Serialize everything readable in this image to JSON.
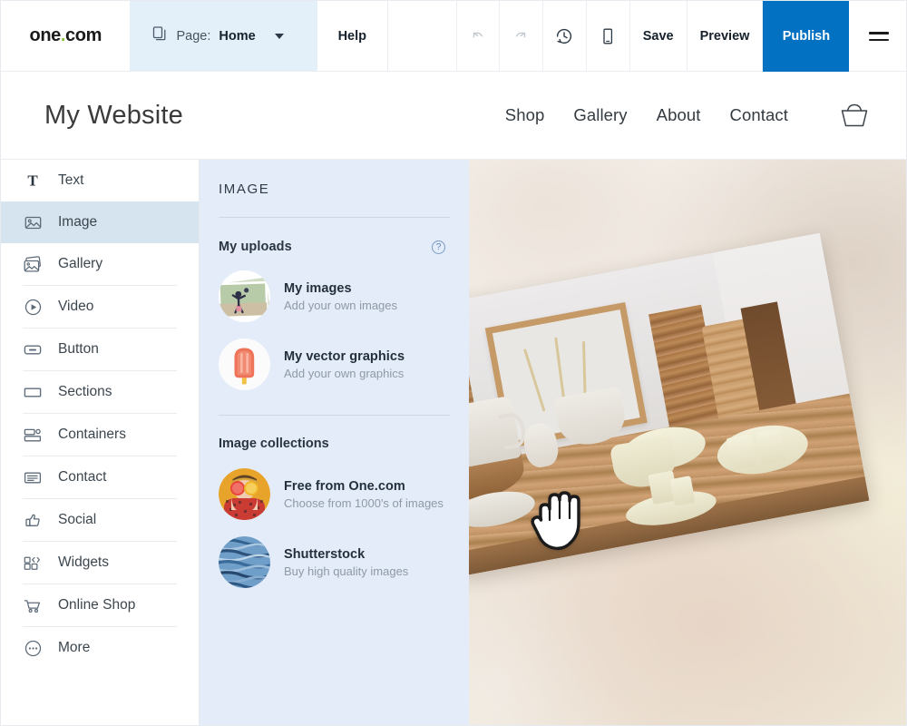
{
  "toolbar": {
    "logo": "one.com",
    "logo_main": "one",
    "logo_dot": ".",
    "logo_suffix": "com",
    "page_label": "Page:",
    "page_value": "Home",
    "help_label": "Help",
    "undo_icon": "undo-icon",
    "redo_icon": "redo-icon",
    "history_icon": "history-clock-icon",
    "mobile_icon": "mobile-preview-icon",
    "save_label": "Save",
    "preview_label": "Preview",
    "publish_label": "Publish",
    "menu_icon": "hamburger-menu-icon",
    "publish_color": "#0271c2",
    "page_bg_color": "#e3f0fa"
  },
  "site_header": {
    "title": "My Website",
    "nav": [
      {
        "label": "Shop"
      },
      {
        "label": "Gallery"
      },
      {
        "label": "About"
      },
      {
        "label": "Contact"
      }
    ],
    "cart_icon": "shopping-basket-icon"
  },
  "sidebar": {
    "items": [
      {
        "label": "Text",
        "icon": "text-t-icon",
        "active": false
      },
      {
        "label": "Image",
        "icon": "image-icon",
        "active": true
      },
      {
        "label": "Gallery",
        "icon": "gallery-stack-icon",
        "active": false
      },
      {
        "label": "Video",
        "icon": "video-play-icon",
        "active": false
      },
      {
        "label": "Button",
        "icon": "button-icon",
        "active": false
      },
      {
        "label": "Sections",
        "icon": "sections-icon",
        "active": false
      },
      {
        "label": "Containers",
        "icon": "containers-icon",
        "active": false
      },
      {
        "label": "Contact",
        "icon": "contact-form-icon",
        "active": false
      },
      {
        "label": "Social",
        "icon": "thumbs-up-icon",
        "active": false
      },
      {
        "label": "Widgets",
        "icon": "widgets-code-icon",
        "active": false
      },
      {
        "label": "Online Shop",
        "icon": "shopping-cart-icon",
        "active": false
      },
      {
        "label": "More",
        "icon": "more-dots-icon",
        "active": false
      }
    ],
    "active_bg_color": "#d6e4f0"
  },
  "panel": {
    "title": "IMAGE",
    "bg_color": "#e3ecf8",
    "uploads": {
      "section_title": "My uploads",
      "help_icon": "help-question-icon",
      "help_glyph": "?",
      "items": [
        {
          "title": "My images",
          "subtitle": "Add your own images",
          "thumb": "photo-stack-thumb"
        },
        {
          "title": "My vector graphics",
          "subtitle": "Add your own graphics",
          "thumb": "popsicle-thumb"
        }
      ]
    },
    "collections": {
      "section_title": "Image collections",
      "items": [
        {
          "title": "Free from One.com",
          "subtitle": "Choose from 1000's of images",
          "thumb": "citrus-person-thumb"
        },
        {
          "title": "Shutterstock",
          "subtitle": "Buy high quality images",
          "thumb": "ocean-water-thumb"
        }
      ]
    }
  },
  "canvas": {
    "dragged_image_name": "pottery-shelf-photo",
    "dragged_image_rotation": "-10.5deg",
    "cursor_icon": "grabbing-hand-cursor",
    "background_description": "blurred-warm-photo-backdrop"
  }
}
